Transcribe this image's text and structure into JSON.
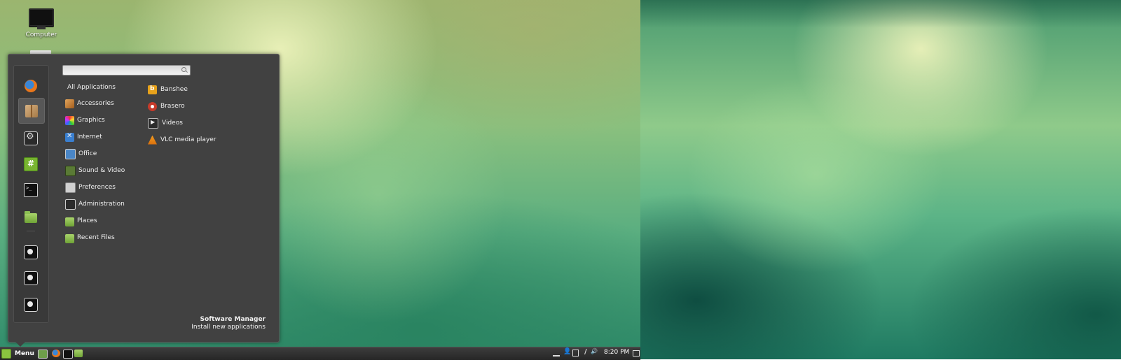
{
  "desktop": {
    "icons": [
      {
        "label": "Computer",
        "icon": "computer-icon"
      }
    ]
  },
  "menu": {
    "favorites": [
      {
        "name": "firefox",
        "icon": "firefox-icon"
      },
      {
        "name": "software-manager",
        "icon": "package-icon"
      },
      {
        "name": "system-settings",
        "icon": "settings-icon"
      },
      {
        "name": "hexchat",
        "icon": "hash-icon"
      },
      {
        "name": "terminal",
        "icon": "terminal-icon"
      },
      {
        "name": "files",
        "icon": "folder-icon"
      },
      {
        "name": "lock-screen",
        "icon": "lock-icon"
      },
      {
        "name": "logout",
        "icon": "logout-icon"
      },
      {
        "name": "shutdown",
        "icon": "power-icon"
      }
    ],
    "search": {
      "value": "",
      "placeholder": ""
    },
    "categories": [
      {
        "label": "All Applications"
      },
      {
        "label": "Accessories"
      },
      {
        "label": "Graphics"
      },
      {
        "label": "Internet"
      },
      {
        "label": "Office"
      },
      {
        "label": "Sound & Video"
      },
      {
        "label": "Preferences"
      },
      {
        "label": "Administration"
      },
      {
        "label": "Places"
      },
      {
        "label": "Recent Files"
      }
    ],
    "applications": [
      {
        "label": "Banshee"
      },
      {
        "label": "Brasero"
      },
      {
        "label": "Videos"
      },
      {
        "label": "VLC media player"
      }
    ],
    "info": {
      "title": "Software Manager",
      "description": "Install new applications"
    }
  },
  "panel": {
    "menu_label": "Menu",
    "launchers": [
      "show-desktop",
      "firefox",
      "terminal",
      "files"
    ],
    "clock": "8:20 PM"
  }
}
